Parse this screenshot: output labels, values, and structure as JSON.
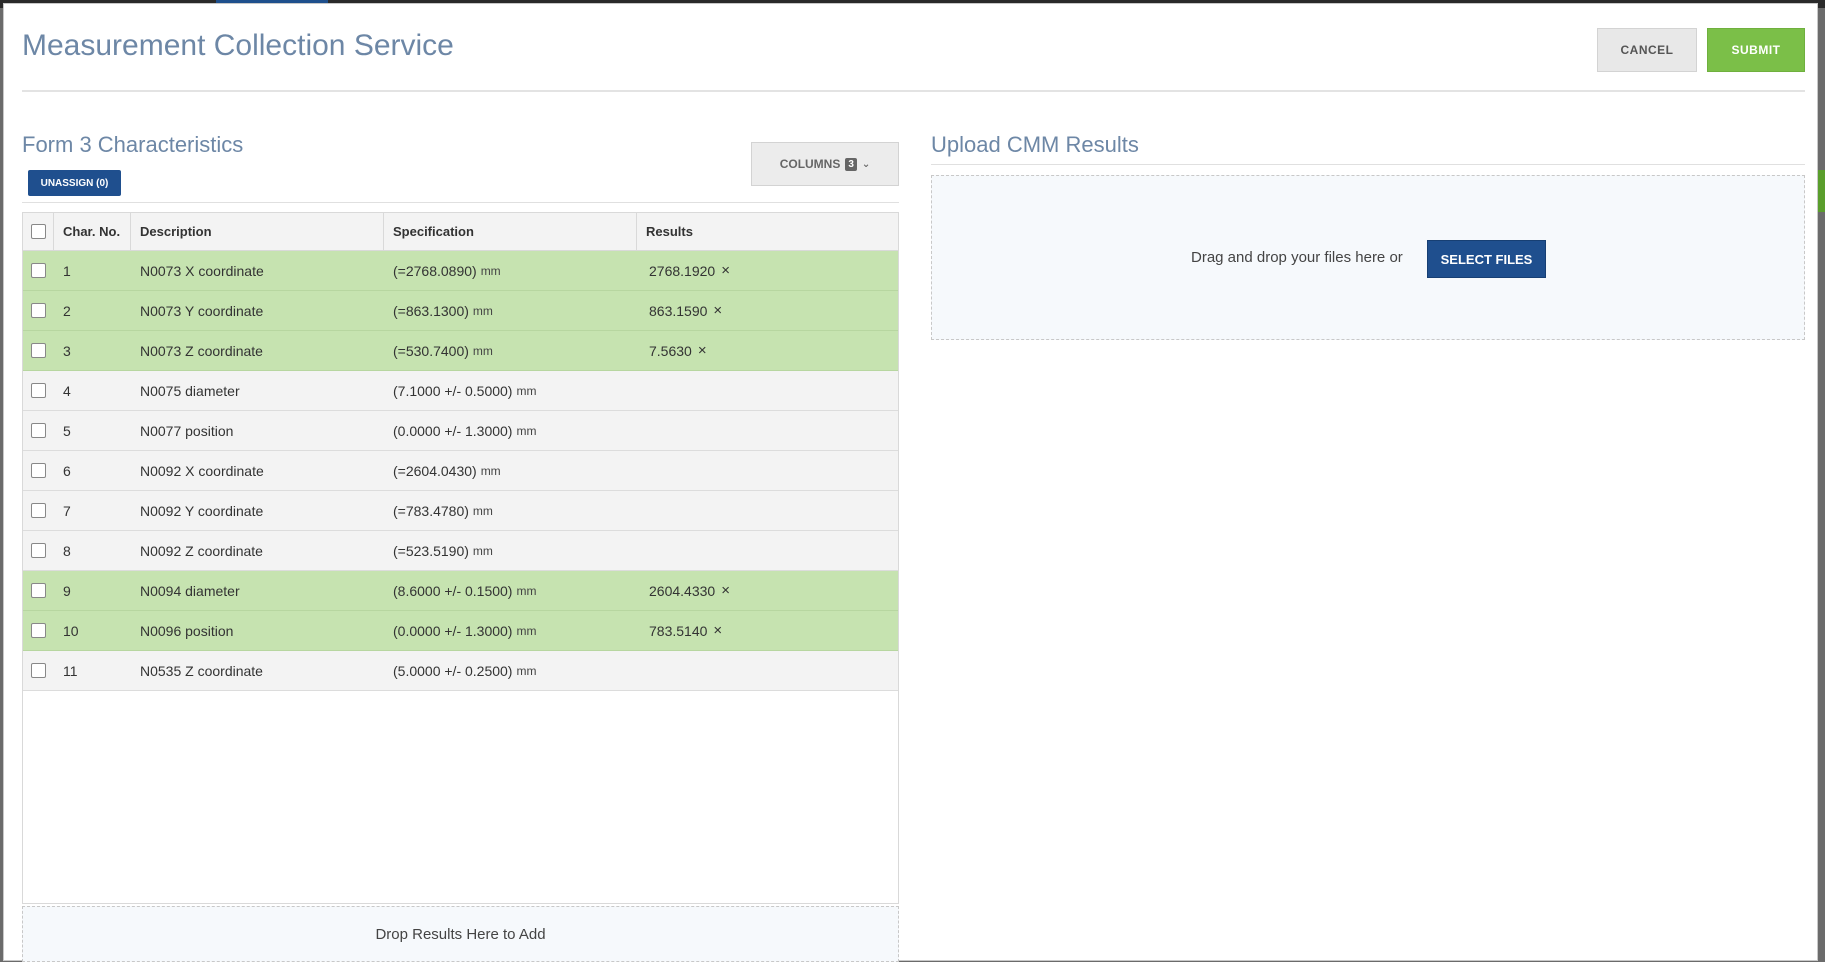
{
  "modal": {
    "title": "Measurement Collection Service",
    "cancel_label": "CANCEL",
    "submit_label": "SUBMIT"
  },
  "characteristics": {
    "title": "Form 3 Characteristics",
    "unassign_label": "UNASSIGN (0)",
    "columns_label": "COLUMNS",
    "columns_count": "3",
    "headers": {
      "char_no": "Char. No.",
      "description": "Description",
      "specification": "Specification",
      "results": "Results"
    },
    "rows": [
      {
        "no": "1",
        "description": "N0073 X coordinate",
        "spec": "(=2768.0890)",
        "unit": "mm",
        "result": "2768.1920",
        "highlighted": true
      },
      {
        "no": "2",
        "description": "N0073 Y coordinate",
        "spec": "(=863.1300)",
        "unit": "mm",
        "result": "863.1590",
        "highlighted": true
      },
      {
        "no": "3",
        "description": "N0073 Z coordinate",
        "spec": "(=530.7400)",
        "unit": "mm",
        "result": "7.5630",
        "highlighted": true
      },
      {
        "no": "4",
        "description": "N0075 diameter",
        "spec": "(7.1000 +/- 0.5000)",
        "unit": "mm",
        "result": "",
        "highlighted": false
      },
      {
        "no": "5",
        "description": "N0077 position",
        "spec": "(0.0000 +/- 1.3000)",
        "unit": "mm",
        "result": "",
        "highlighted": false
      },
      {
        "no": "6",
        "description": "N0092 X coordinate",
        "spec": "(=2604.0430)",
        "unit": "mm",
        "result": "",
        "highlighted": false
      },
      {
        "no": "7",
        "description": "N0092 Y coordinate",
        "spec": "(=783.4780)",
        "unit": "mm",
        "result": "",
        "highlighted": false
      },
      {
        "no": "8",
        "description": "N0092 Z coordinate",
        "spec": "(=523.5190)",
        "unit": "mm",
        "result": "",
        "highlighted": false
      },
      {
        "no": "9",
        "description": "N0094 diameter",
        "spec": "(8.6000 +/- 0.1500)",
        "unit": "mm",
        "result": "2604.4330",
        "highlighted": true
      },
      {
        "no": "10",
        "description": "N0096 position",
        "spec": "(0.0000 +/- 1.3000)",
        "unit": "mm",
        "result": "783.5140",
        "highlighted": true
      },
      {
        "no": "11",
        "description": "N0535 Z coordinate",
        "spec": "(5.0000 +/- 0.2500)",
        "unit": "mm",
        "result": "",
        "highlighted": false
      }
    ],
    "drop_zone_label": "Drop Results Here to Add"
  },
  "upload": {
    "title": "Upload CMM Results",
    "drag_text": "Drag and drop your files here or",
    "select_label": "SELECT FILES"
  },
  "icons": {
    "remove": "×",
    "chevron": "⌄"
  },
  "colors": {
    "title_blue": "#6d87a6",
    "primary_blue": "#1f4f8e",
    "submit_green": "#7bbf48",
    "row_highlight": "#c6e3b0"
  }
}
